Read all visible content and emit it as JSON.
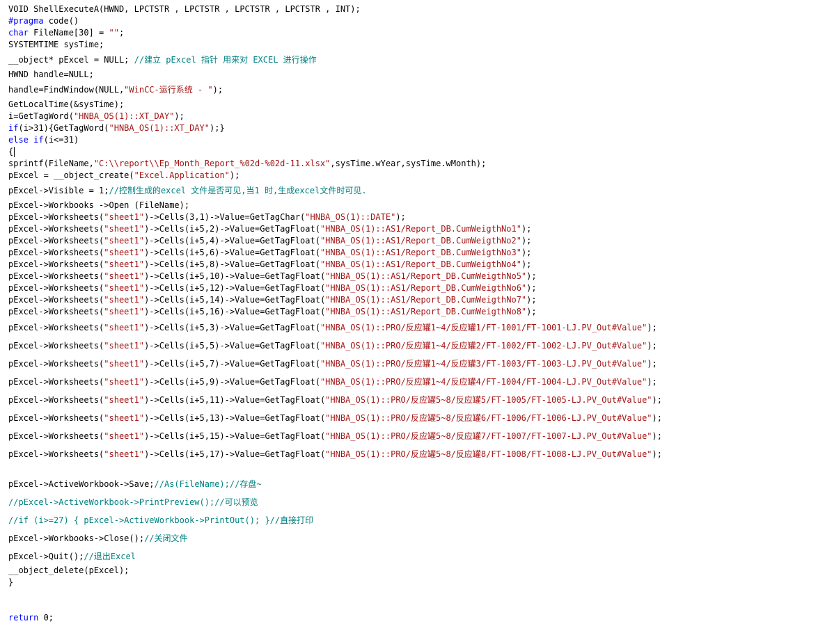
{
  "editor": {
    "colors": {
      "plain": "#000000",
      "keyword": "#0000ff",
      "string": "#a31515",
      "comment": "#008080",
      "background": "#ffffff"
    },
    "lines": [
      [
        [
          "p",
          "VOID ShellExecuteA(HWND, LPCTSTR , LPCTSTR , LPCTSTR , LPCTSTR , INT);"
        ]
      ],
      [
        [
          "k",
          "#pragma"
        ],
        [
          "p",
          " code()"
        ]
      ],
      [
        [
          "k",
          "char"
        ],
        [
          "p",
          " FileName[30] = "
        ],
        [
          "s",
          "\"\""
        ],
        [
          "p",
          ";"
        ]
      ],
      [
        [
          "p",
          "SYSTEMTIME sysTime;"
        ]
      ],
      [
        [
          "p",
          "__object* pExcel = NULL; "
        ],
        [
          "c",
          "//建立 pExcel 指针 用来对 EXCEL 进行操作"
        ]
      ],
      [
        [
          "p",
          "HWND handle=NULL;"
        ]
      ],
      [
        [
          "p",
          "handle=FindWindow(NULL,"
        ],
        [
          "s",
          "\"WinCC-运行系统 - \""
        ],
        [
          "p",
          ");"
        ]
      ],
      [
        [
          "p",
          "GetLocalTime(&sysTime);"
        ]
      ],
      [
        [
          "p",
          "i=GetTagWord("
        ],
        [
          "s",
          "\"HNBA_OS(1)::XT_DAY\""
        ],
        [
          "p",
          ");"
        ]
      ],
      [
        [
          "k",
          "if"
        ],
        [
          "p",
          "(i>31){GetTagWord("
        ],
        [
          "s",
          "\"HNBA_OS(1)::XT_DAY\""
        ],
        [
          "p",
          ");}"
        ]
      ],
      [
        [
          "k",
          "else"
        ],
        [
          "p",
          " "
        ],
        [
          "k",
          "if"
        ],
        [
          "p",
          "(i<=31)"
        ]
      ],
      [
        [
          "p",
          "{"
        ]
      ],
      [
        [
          "p",
          "sprintf(FileName,"
        ],
        [
          "s",
          "\"C:\\\\report\\\\Ep_Month_Report_%02d-%02d-11.xlsx\""
        ],
        [
          "p",
          ",sysTime.wYear,sysTime.wMonth);"
        ]
      ],
      [
        [
          "p",
          "pExcel = __object_create("
        ],
        [
          "s",
          "\"Excel.Application\""
        ],
        [
          "p",
          ");"
        ]
      ],
      [
        [
          "p",
          "pExcel->Visible = 1;"
        ],
        [
          "c",
          "//控制生成的excel 文件是否可见,当1 时,生成excel文件时可见."
        ]
      ],
      [
        [
          "p",
          "pExcel->Workbooks ->Open (FileName);"
        ]
      ],
      [
        [
          "p",
          "pExcel->Worksheets("
        ],
        [
          "s",
          "\"sheet1\""
        ],
        [
          "p",
          ")->Cells(3,1)->Value=GetTagChar("
        ],
        [
          "s",
          "\"HNBA_OS(1)::DATE\""
        ],
        [
          "p",
          ");"
        ]
      ],
      [
        [
          "p",
          "pExcel->Worksheets("
        ],
        [
          "s",
          "\"sheet1\""
        ],
        [
          "p",
          ")->Cells(i+5,2)->Value=GetTagFloat("
        ],
        [
          "s",
          "\"HNBA_OS(1)::AS1/Report_DB.CumWeigthNo1\""
        ],
        [
          "p",
          ");"
        ]
      ],
      [
        [
          "p",
          "pExcel->Worksheets("
        ],
        [
          "s",
          "\"sheet1\""
        ],
        [
          "p",
          ")->Cells(i+5,4)->Value=GetTagFloat("
        ],
        [
          "s",
          "\"HNBA_OS(1)::AS1/Report_DB.CumWeigthNo2\""
        ],
        [
          "p",
          ");"
        ]
      ],
      [
        [
          "p",
          "pExcel->Worksheets("
        ],
        [
          "s",
          "\"sheet1\""
        ],
        [
          "p",
          ")->Cells(i+5,6)->Value=GetTagFloat("
        ],
        [
          "s",
          "\"HNBA_OS(1)::AS1/Report_DB.CumWeigthNo3\""
        ],
        [
          "p",
          ");"
        ]
      ],
      [
        [
          "p",
          "pExcel->Worksheets("
        ],
        [
          "s",
          "\"sheet1\""
        ],
        [
          "p",
          ")->Cells(i+5,8)->Value=GetTagFloat("
        ],
        [
          "s",
          "\"HNBA_OS(1)::AS1/Report_DB.CumWeigthNo4\""
        ],
        [
          "p",
          ");"
        ]
      ],
      [
        [
          "p",
          "pExcel->Worksheets("
        ],
        [
          "s",
          "\"sheet1\""
        ],
        [
          "p",
          ")->Cells(i+5,10)->Value=GetTagFloat("
        ],
        [
          "s",
          "\"HNBA_OS(1)::AS1/Report_DB.CumWeigthNo5\""
        ],
        [
          "p",
          ");"
        ]
      ],
      [
        [
          "p",
          "pExcel->Worksheets("
        ],
        [
          "s",
          "\"sheet1\""
        ],
        [
          "p",
          ")->Cells(i+5,12)->Value=GetTagFloat("
        ],
        [
          "s",
          "\"HNBA_OS(1)::AS1/Report_DB.CumWeigthNo6\""
        ],
        [
          "p",
          ");"
        ]
      ],
      [
        [
          "p",
          "pExcel->Worksheets("
        ],
        [
          "s",
          "\"sheet1\""
        ],
        [
          "p",
          ")->Cells(i+5,14)->Value=GetTagFloat("
        ],
        [
          "s",
          "\"HNBA_OS(1)::AS1/Report_DB.CumWeigthNo7\""
        ],
        [
          "p",
          ");"
        ]
      ],
      [
        [
          "p",
          "pExcel->Worksheets("
        ],
        [
          "s",
          "\"sheet1\""
        ],
        [
          "p",
          ")->Cells(i+5,16)->Value=GetTagFloat("
        ],
        [
          "s",
          "\"HNBA_OS(1)::AS1/Report_DB.CumWeigthNo8\""
        ],
        [
          "p",
          ");"
        ]
      ],
      [
        [
          "p",
          "pExcel->Worksheets("
        ],
        [
          "s",
          "\"sheet1\""
        ],
        [
          "p",
          ")->Cells(i+5,3)->Value=GetTagFloat("
        ],
        [
          "s",
          "\"HNBA_OS(1)::PRO/反应罐1~4/反应罐1/FT-1001/FT-1001-LJ.PV_Out#Value\""
        ],
        [
          "p",
          ");"
        ]
      ],
      [
        [
          "p",
          "pExcel->Worksheets("
        ],
        [
          "s",
          "\"sheet1\""
        ],
        [
          "p",
          ")->Cells(i+5,5)->Value=GetTagFloat("
        ],
        [
          "s",
          "\"HNBA_OS(1)::PRO/反应罐1~4/反应罐2/FT-1002/FT-1002-LJ.PV_Out#Value\""
        ],
        [
          "p",
          ");"
        ]
      ],
      [
        [
          "p",
          "pExcel->Worksheets("
        ],
        [
          "s",
          "\"sheet1\""
        ],
        [
          "p",
          ")->Cells(i+5,7)->Value=GetTagFloat("
        ],
        [
          "s",
          "\"HNBA_OS(1)::PRO/反应罐1~4/反应罐3/FT-1003/FT-1003-LJ.PV_Out#Value\""
        ],
        [
          "p",
          ");"
        ]
      ],
      [
        [
          "p",
          "pExcel->Worksheets("
        ],
        [
          "s",
          "\"sheet1\""
        ],
        [
          "p",
          ")->Cells(i+5,9)->Value=GetTagFloat("
        ],
        [
          "s",
          "\"HNBA_OS(1)::PRO/反应罐1~4/反应罐4/FT-1004/FT-1004-LJ.PV_Out#Value\""
        ],
        [
          "p",
          ");"
        ]
      ],
      [
        [
          "p",
          "pExcel->Worksheets("
        ],
        [
          "s",
          "\"sheet1\""
        ],
        [
          "p",
          ")->Cells(i+5,11)->Value=GetTagFloat("
        ],
        [
          "s",
          "\"HNBA_OS(1)::PRO/反应罐5~8/反应罐5/FT-1005/FT-1005-LJ.PV_Out#Value\""
        ],
        [
          "p",
          ");"
        ]
      ],
      [
        [
          "p",
          "pExcel->Worksheets("
        ],
        [
          "s",
          "\"sheet1\""
        ],
        [
          "p",
          ")->Cells(i+5,13)->Value=GetTagFloat("
        ],
        [
          "s",
          "\"HNBA_OS(1)::PRO/反应罐5~8/反应罐6/FT-1006/FT-1006-LJ.PV_Out#Value\""
        ],
        [
          "p",
          ");"
        ]
      ],
      [
        [
          "p",
          "pExcel->Worksheets("
        ],
        [
          "s",
          "\"sheet1\""
        ],
        [
          "p",
          ")->Cells(i+5,15)->Value=GetTagFloat("
        ],
        [
          "s",
          "\"HNBA_OS(1)::PRO/反应罐5~8/反应罐7/FT-1007/FT-1007-LJ.PV_Out#Value\""
        ],
        [
          "p",
          ");"
        ]
      ],
      [
        [
          "p",
          "pExcel->Worksheets("
        ],
        [
          "s",
          "\"sheet1\""
        ],
        [
          "p",
          ")->Cells(i+5,17)->Value=GetTagFloat("
        ],
        [
          "s",
          "\"HNBA_OS(1)::PRO/反应罐5~8/反应罐8/FT-1008/FT-1008-LJ.PV_Out#Value\""
        ],
        [
          "p",
          ");"
        ]
      ],
      [
        [
          "p",
          "pExcel->ActiveWorkbook->Save;"
        ],
        [
          "c",
          "//As(FileName);//存盘~"
        ]
      ],
      [
        [
          "c",
          "//pExcel->ActiveWorkbook->PrintPreview();//可以预览"
        ]
      ],
      [
        [
          "c",
          "//if (i>=27) { pExcel->ActiveWorkbook->PrintOut(); }//直接打印"
        ]
      ],
      [
        [
          "p",
          "pExcel->Workbooks->Close();"
        ],
        [
          "c",
          "//关闭文件"
        ]
      ],
      [
        [
          "p",
          "pExcel->Quit();"
        ],
        [
          "c",
          "//退出Excel"
        ]
      ],
      [
        [
          "p",
          "__object_delete(pExcel);"
        ]
      ],
      [
        [
          "p",
          "}"
        ]
      ],
      [
        [
          "k",
          "return"
        ],
        [
          "p",
          " 0;"
        ]
      ]
    ]
  }
}
